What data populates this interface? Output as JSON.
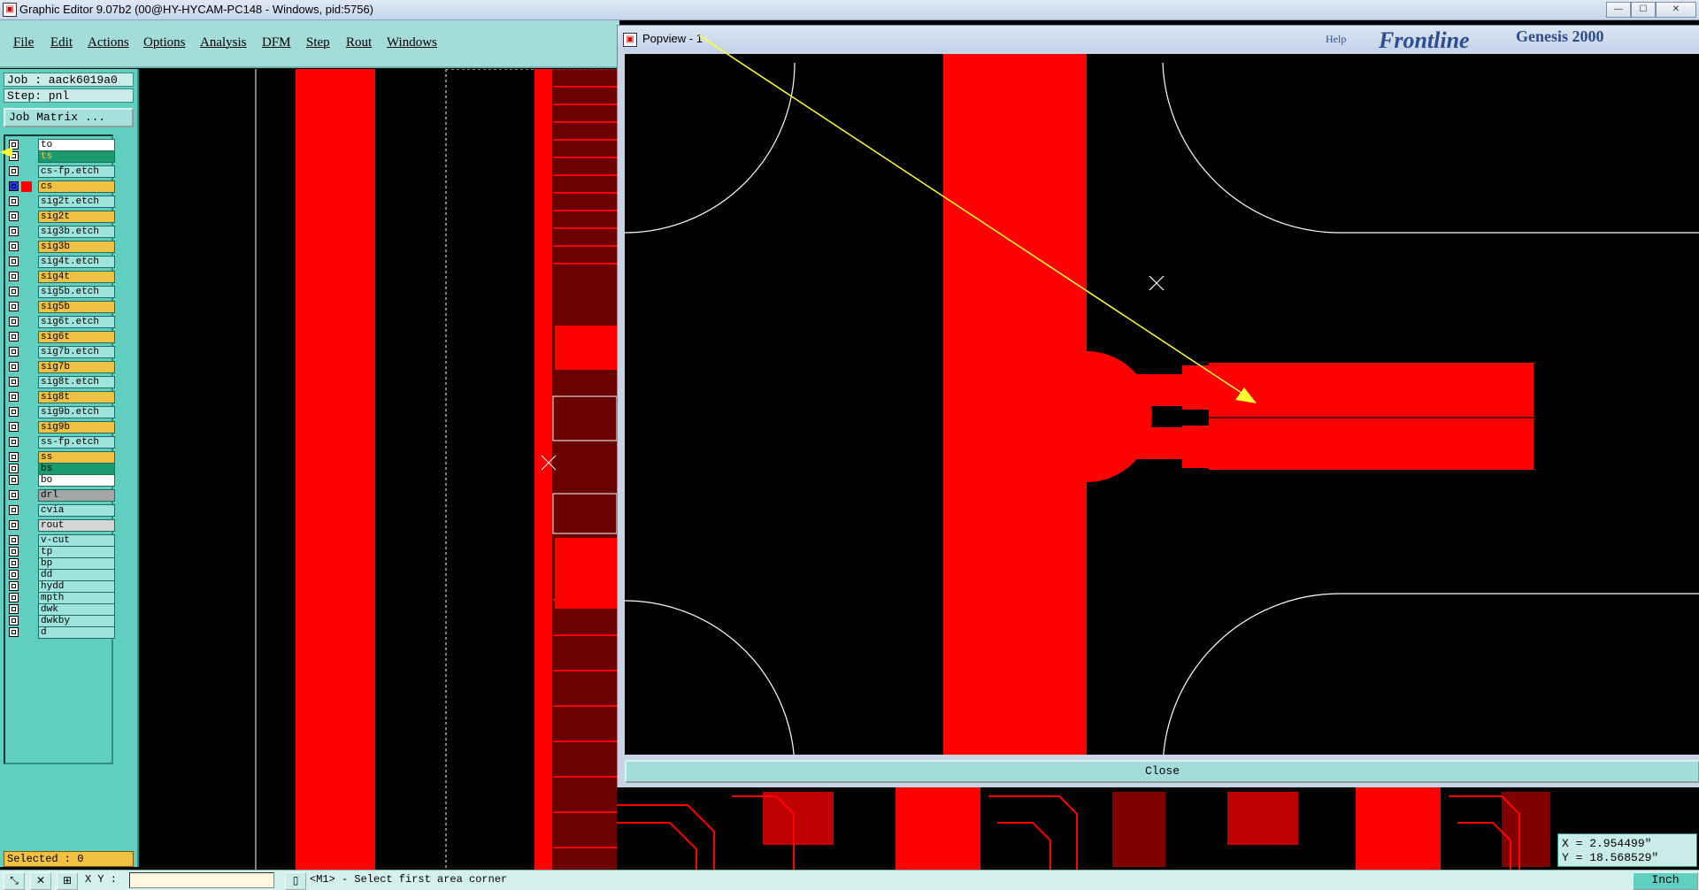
{
  "window": {
    "title": "Graphic Editor 9.07b2 (00@HY-HYCAM-PC148 - Windows, pid:5756)",
    "minimize": "—",
    "maximize": "☐",
    "close": "✕"
  },
  "menu": [
    "File",
    "Edit",
    "Actions",
    "Options",
    "Analysis",
    "DFM",
    "Step",
    "Rout",
    "Windows"
  ],
  "job": {
    "job": "Job : aack6019a0",
    "step": "Step: pnl",
    "matrix_button": "Job Matrix ..."
  },
  "layers": [
    {
      "name": "to",
      "color": "#ffffff"
    },
    {
      "name": "ts",
      "color": "#1a9a6e",
      "active": true
    },
    {
      "name": "cs-fp.etch",
      "color": "#9ee3dc"
    },
    {
      "name": "cs",
      "color": "#f2c043",
      "work": true
    },
    {
      "name": "sig2t.etch",
      "color": "#9ee3dc"
    },
    {
      "name": "sig2t",
      "color": "#f2c043"
    },
    {
      "name": "sig3b.etch",
      "color": "#9ee3dc"
    },
    {
      "name": "sig3b",
      "color": "#f2c043"
    },
    {
      "name": "sig4t.etch",
      "color": "#9ee3dc"
    },
    {
      "name": "sig4t",
      "color": "#f2c043"
    },
    {
      "name": "sig5b.etch",
      "color": "#9ee3dc"
    },
    {
      "name": "sig5b",
      "color": "#f2c043"
    },
    {
      "name": "sig6t.etch",
      "color": "#9ee3dc"
    },
    {
      "name": "sig6t",
      "color": "#f2c043"
    },
    {
      "name": "sig7b.etch",
      "color": "#9ee3dc"
    },
    {
      "name": "sig7b",
      "color": "#f2c043"
    },
    {
      "name": "sig8t.etch",
      "color": "#9ee3dc"
    },
    {
      "name": "sig8t",
      "color": "#f2c043"
    },
    {
      "name": "sig9b.etch",
      "color": "#9ee3dc"
    },
    {
      "name": "sig9b",
      "color": "#f2c043"
    },
    {
      "name": "ss-fp.etch",
      "color": "#9ee3dc"
    },
    {
      "name": "ss",
      "color": "#f2c043"
    },
    {
      "name": "bs",
      "color": "#1a9a6e"
    },
    {
      "name": "bo",
      "color": "#ffffff"
    },
    {
      "name": "drl",
      "color": "#a6a6a6"
    },
    {
      "name": "cvia",
      "color": "#9ee3dc"
    },
    {
      "name": "rout",
      "color": "#d6d6d6"
    },
    {
      "name": "v-cut",
      "color": "#9ee3dc"
    },
    {
      "name": "tp",
      "color": "#9ee3dc"
    },
    {
      "name": "bp",
      "color": "#9ee3dc"
    },
    {
      "name": "dd",
      "color": "#9ee3dc"
    },
    {
      "name": "hydd",
      "color": "#9ee3dc"
    },
    {
      "name": "mpth",
      "color": "#9ee3dc"
    },
    {
      "name": "dwk",
      "color": "#9ee3dc"
    },
    {
      "name": "dwkby",
      "color": "#9ee3dc"
    },
    {
      "name": "d",
      "color": "#9ee3dc"
    }
  ],
  "selected": "Selected : 0",
  "popview": {
    "title": "Popview - 1",
    "close_label": "Close",
    "bg_brand": "Frontline",
    "bg_product": "Genesis 2000",
    "bg_help": "Help"
  },
  "coords": {
    "x": "X = 2.954499\"",
    "y": "Y = 18.568529\""
  },
  "status": {
    "xy_label": "X Y :",
    "message": "<M1> - Select first area corner",
    "units": "Inch"
  },
  "colors": {
    "copper": "#ff0000",
    "panel": "#60cfbf",
    "menu": "#a3dcd8",
    "arrow": "#ffff33"
  }
}
